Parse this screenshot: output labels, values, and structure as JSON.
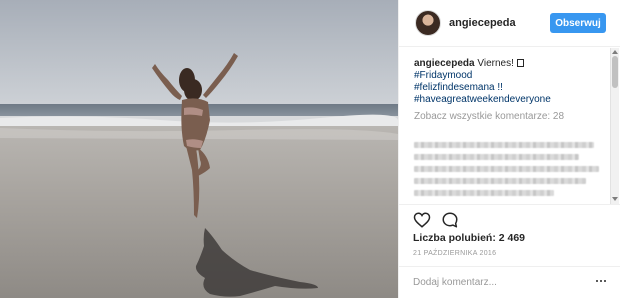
{
  "post": {
    "username": "angiecepeda",
    "follow_label": "Obserwuj",
    "caption": {
      "username": "angiecepeda",
      "text": "Viernes!",
      "hashtags": [
        "#Fridaymood",
        "#felizfindesemana !!",
        "#haveagreatweekendeveryone"
      ]
    },
    "view_all_comments": "Zobacz wszystkie komentarze: 28",
    "likes": "Liczba polubień: 2 469",
    "date": "21 PAŹDZIERNIKA 2016",
    "comment_placeholder": "Dodaj komentarz..."
  },
  "icons": {
    "like": "heart-outline-icon",
    "comment": "speech-bubble-icon",
    "more": "ellipsis-icon",
    "avatar": "profile-avatar"
  },
  "colors": {
    "follow_button": "#3897f0",
    "hashtag": "#003569",
    "muted_text": "#999999",
    "border": "#efefef"
  }
}
